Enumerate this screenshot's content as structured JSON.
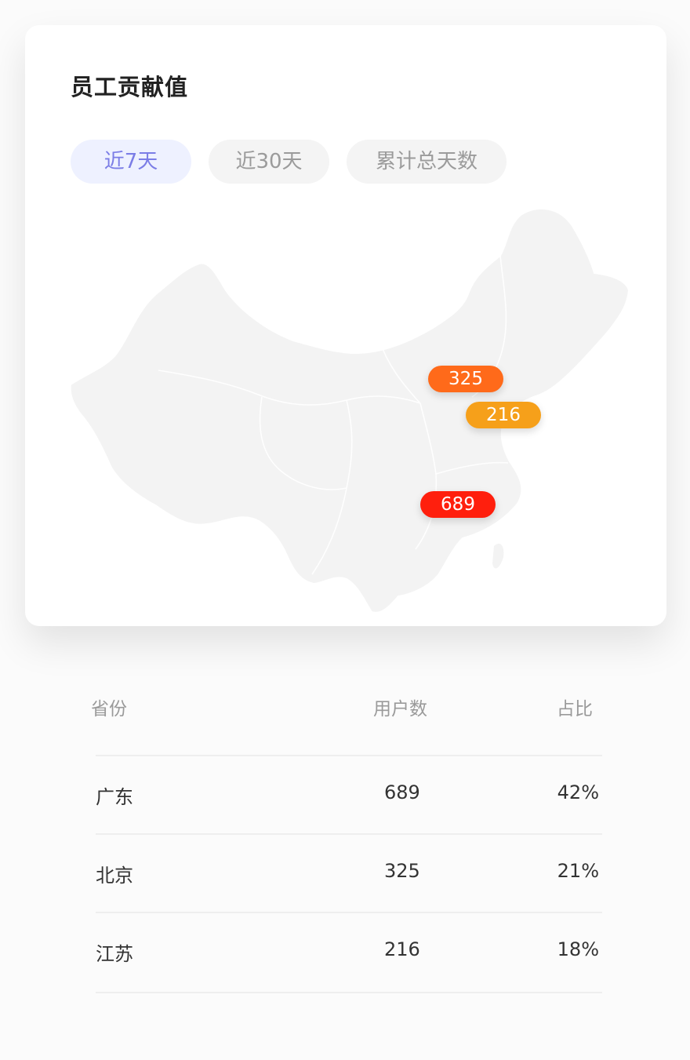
{
  "card": {
    "title": "员工贡献值",
    "tabs": [
      {
        "label": "近7天",
        "active": true
      },
      {
        "label": "近30天",
        "active": false
      },
      {
        "label": "累计总天数",
        "active": false
      }
    ],
    "map_markers": [
      {
        "province": "北京",
        "value": "325",
        "color": "#ff6a1a"
      },
      {
        "province": "江苏",
        "value": "216",
        "color": "#f6a01a"
      },
      {
        "province": "广东",
        "value": "689",
        "color": "#ff1f0d"
      }
    ]
  },
  "table": {
    "headers": {
      "province": "省份",
      "users": "用户数",
      "ratio": "占比"
    },
    "rows": [
      {
        "province": "广东",
        "users": "689",
        "ratio": "42%"
      },
      {
        "province": "北京",
        "users": "325",
        "ratio": "21%"
      },
      {
        "province": "江苏",
        "users": "216",
        "ratio": "18%"
      }
    ]
  },
  "colors": {
    "active_tab_bg": "#eef1ff",
    "active_tab_text": "#7b7de6",
    "inactive_tab_bg": "#f4f4f4",
    "inactive_tab_text": "#9b9b9b"
  }
}
